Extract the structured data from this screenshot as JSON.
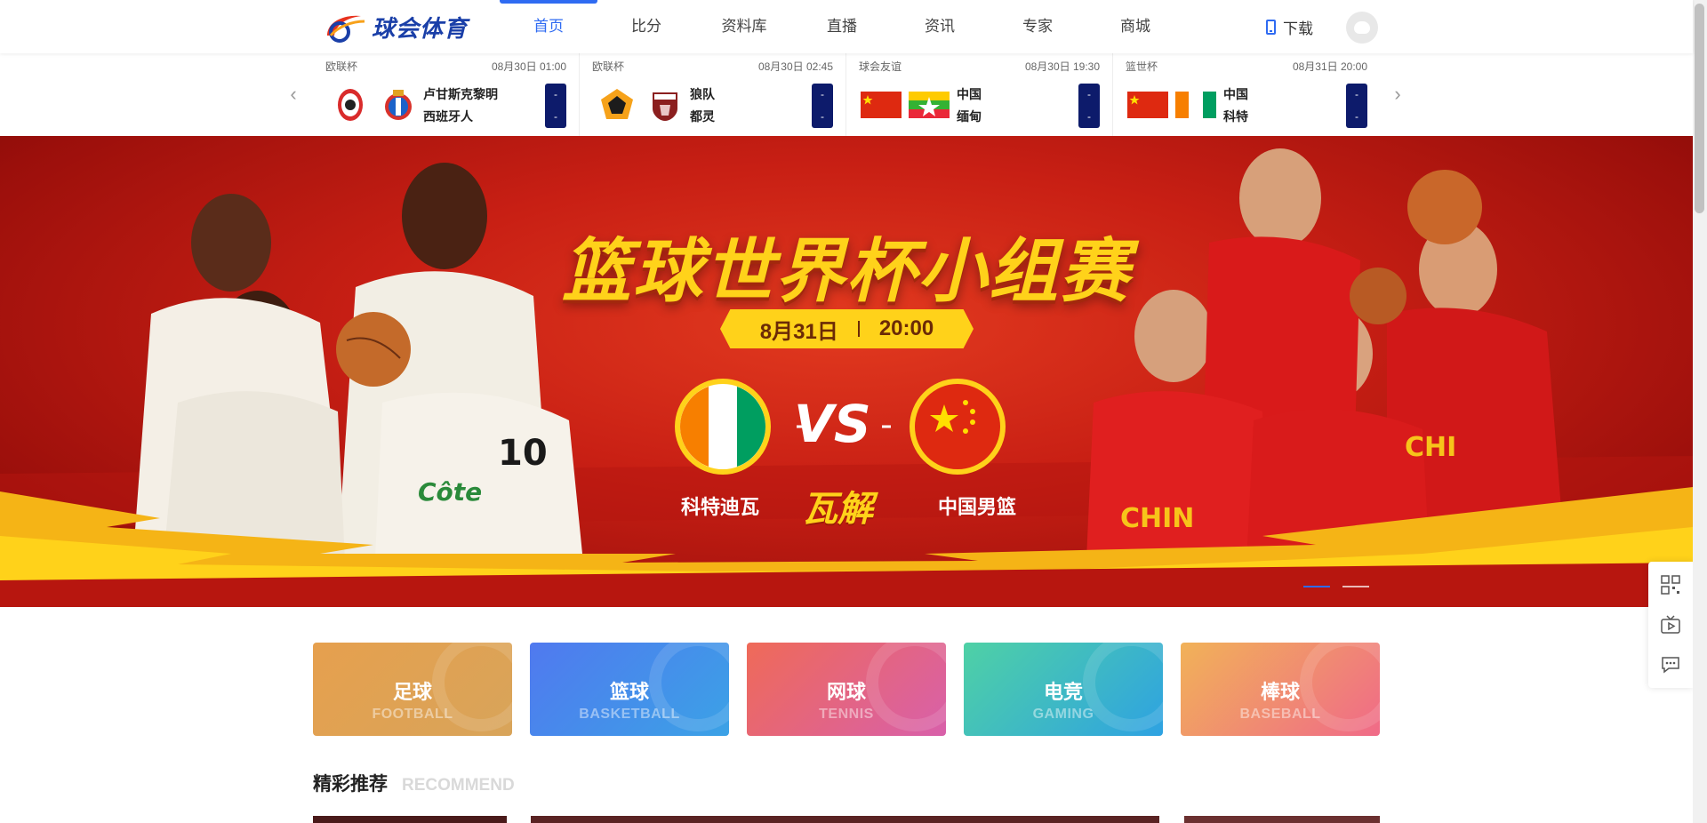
{
  "header": {
    "logo_text": "球会体育",
    "nav": [
      "首页",
      "比分",
      "资料库",
      "直播",
      "资讯",
      "专家",
      "商城"
    ],
    "active_nav": "首页",
    "download_label": "下载"
  },
  "matches": [
    {
      "league": "欧联杯",
      "time": "08月30日 01:00",
      "home": "卢甘斯克黎明",
      "away": "西班牙人",
      "home_score": "-",
      "away_score": "-"
    },
    {
      "league": "欧联杯",
      "time": "08月30日 02:45",
      "home": "狼队",
      "away": "都灵",
      "home_score": "-",
      "away_score": "-"
    },
    {
      "league": "球会友谊",
      "time": "08月30日 19:30",
      "home": "中国",
      "away": "缅甸",
      "home_score": "-",
      "away_score": "-"
    },
    {
      "league": "篮世杯",
      "time": "08月31日 20:00",
      "home": "中国",
      "away": "科特",
      "home_score": "-",
      "away_score": "-"
    }
  ],
  "banner": {
    "title": "篮球世界杯小组赛",
    "date": "8月31日",
    "time": "20:00",
    "vs": "VS",
    "team_left": "科特迪瓦",
    "team_right": "中国男篮",
    "brand": "瓦解",
    "slides": 2,
    "active_slide": 1
  },
  "sports": [
    {
      "cn": "足球",
      "en": "FOOTBALL",
      "from": "#e7a24f",
      "to": "#d9a357"
    },
    {
      "cn": "篮球",
      "en": "BASKETBALL",
      "from": "#4f7ef0",
      "to": "#3aa0e8"
    },
    {
      "cn": "网球",
      "en": "TENNIS",
      "from": "#ee6a5a",
      "to": "#d660a8"
    },
    {
      "cn": "电竞",
      "en": "GAMING",
      "from": "#4fd0a6",
      "to": "#2ea3e0"
    },
    {
      "cn": "棒球",
      "en": "BASEBALL",
      "from": "#f0b25a",
      "to": "#f06a86"
    }
  ],
  "recommend": {
    "cn": "精彩推荐",
    "en": "RECOMMEND"
  },
  "colors": {
    "accent": "#2f6bf2",
    "score_box": "#0d1b6b",
    "banner_red": "#c81f14",
    "banner_gold": "#ffd21a"
  }
}
